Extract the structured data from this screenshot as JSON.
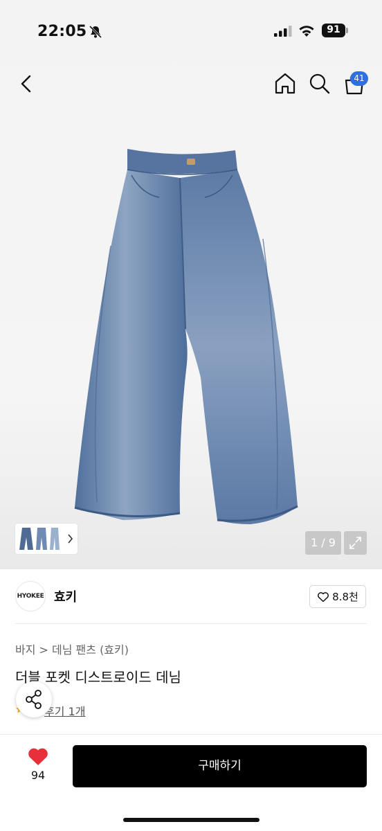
{
  "status_bar": {
    "time": "22:05",
    "battery": "91"
  },
  "nav": {
    "cart_count": "41"
  },
  "gallery": {
    "pager": "1 / 9"
  },
  "shop": {
    "logo_text": "HYOKEE",
    "name": "효키",
    "likes": "8.8천"
  },
  "product": {
    "breadcrumb": "바지 > 데님 팬츠 (효키)",
    "title": "더블 포켓 디스트로이드 데님",
    "review": "후기 1개"
  },
  "bottom_bar": {
    "like_count": "94",
    "buy_label": "구매하기"
  },
  "colors": {
    "accent_badge": "#2f6fe4",
    "heart": "#e8303a",
    "buy_bg": "#000000"
  },
  "icons": [
    "back-icon",
    "home-icon",
    "search-icon",
    "cart-icon",
    "expand-icon",
    "share-icon",
    "heart-icon",
    "star-icon"
  ]
}
